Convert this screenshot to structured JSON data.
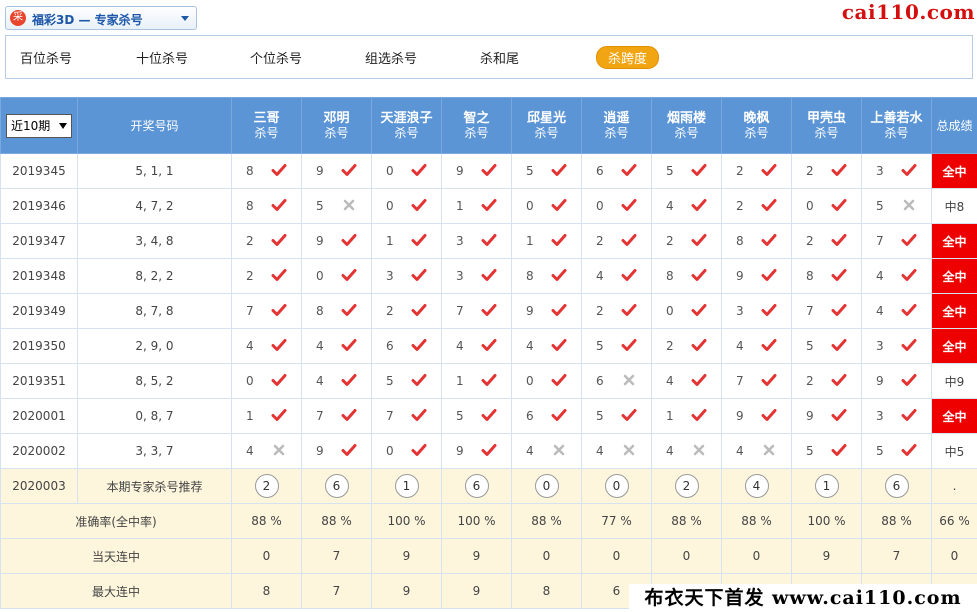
{
  "header": {
    "logo_glyph": "采",
    "game_title": "福彩3D — 专家杀号",
    "site_logo": "cai110.com"
  },
  "tabs": [
    {
      "label": "百位杀号"
    },
    {
      "label": "十位杀号"
    },
    {
      "label": "个位杀号"
    },
    {
      "label": "组选杀号"
    },
    {
      "label": "杀和尾"
    },
    {
      "label": "杀跨度"
    }
  ],
  "table": {
    "period_select": "近10期",
    "draw_header": "开奖号码",
    "total_header": "总成绩",
    "kill_sub": "杀号",
    "experts": [
      "三哥",
      "邓明",
      "天涯浪子",
      "智之",
      "邱星光",
      "逍遥",
      "烟雨楼",
      "晚枫",
      "甲壳虫",
      "上善若水"
    ],
    "rows": [
      {
        "period": "2019345",
        "draw": "5, 1, 1",
        "cells": [
          [
            "8",
            "y"
          ],
          [
            "9",
            "y"
          ],
          [
            "0",
            "y"
          ],
          [
            "9",
            "y"
          ],
          [
            "5",
            "y"
          ],
          [
            "6",
            "y"
          ],
          [
            "5",
            "y"
          ],
          [
            "2",
            "y"
          ],
          [
            "2",
            "y"
          ],
          [
            "3",
            "y"
          ]
        ],
        "total": "全中"
      },
      {
        "period": "2019346",
        "draw": "4, 7, 2",
        "cells": [
          [
            "8",
            "y"
          ],
          [
            "5",
            "n"
          ],
          [
            "0",
            "y"
          ],
          [
            "1",
            "y"
          ],
          [
            "0",
            "y"
          ],
          [
            "0",
            "y"
          ],
          [
            "4",
            "y"
          ],
          [
            "2",
            "y"
          ],
          [
            "0",
            "y"
          ],
          [
            "5",
            "n"
          ]
        ],
        "total": "中8"
      },
      {
        "period": "2019347",
        "draw": "3, 4, 8",
        "cells": [
          [
            "2",
            "y"
          ],
          [
            "9",
            "y"
          ],
          [
            "1",
            "y"
          ],
          [
            "3",
            "y"
          ],
          [
            "1",
            "y"
          ],
          [
            "2",
            "y"
          ],
          [
            "2",
            "y"
          ],
          [
            "8",
            "y"
          ],
          [
            "2",
            "y"
          ],
          [
            "7",
            "y"
          ]
        ],
        "total": "全中"
      },
      {
        "period": "2019348",
        "draw": "8, 2, 2",
        "cells": [
          [
            "2",
            "y"
          ],
          [
            "0",
            "y"
          ],
          [
            "3",
            "y"
          ],
          [
            "3",
            "y"
          ],
          [
            "8",
            "y"
          ],
          [
            "4",
            "y"
          ],
          [
            "8",
            "y"
          ],
          [
            "9",
            "y"
          ],
          [
            "8",
            "y"
          ],
          [
            "4",
            "y"
          ]
        ],
        "total": "全中"
      },
      {
        "period": "2019349",
        "draw": "8, 7, 8",
        "cells": [
          [
            "7",
            "y"
          ],
          [
            "8",
            "y"
          ],
          [
            "2",
            "y"
          ],
          [
            "7",
            "y"
          ],
          [
            "9",
            "y"
          ],
          [
            "2",
            "y"
          ],
          [
            "0",
            "y"
          ],
          [
            "3",
            "y"
          ],
          [
            "7",
            "y"
          ],
          [
            "4",
            "y"
          ]
        ],
        "total": "全中"
      },
      {
        "period": "2019350",
        "draw": "2, 9, 0",
        "cells": [
          [
            "4",
            "y"
          ],
          [
            "4",
            "y"
          ],
          [
            "6",
            "y"
          ],
          [
            "4",
            "y"
          ],
          [
            "4",
            "y"
          ],
          [
            "5",
            "y"
          ],
          [
            "2",
            "y"
          ],
          [
            "4",
            "y"
          ],
          [
            "5",
            "y"
          ],
          [
            "3",
            "y"
          ]
        ],
        "total": "全中"
      },
      {
        "period": "2019351",
        "draw": "8, 5, 2",
        "cells": [
          [
            "0",
            "y"
          ],
          [
            "4",
            "y"
          ],
          [
            "5",
            "y"
          ],
          [
            "1",
            "y"
          ],
          [
            "0",
            "y"
          ],
          [
            "6",
            "n"
          ],
          [
            "4",
            "y"
          ],
          [
            "7",
            "y"
          ],
          [
            "2",
            "y"
          ],
          [
            "9",
            "y"
          ]
        ],
        "total": "中9"
      },
      {
        "period": "2020001",
        "draw": "0, 8, 7",
        "cells": [
          [
            "1",
            "y"
          ],
          [
            "7",
            "y"
          ],
          [
            "7",
            "y"
          ],
          [
            "5",
            "y"
          ],
          [
            "6",
            "y"
          ],
          [
            "5",
            "y"
          ],
          [
            "1",
            "y"
          ],
          [
            "9",
            "y"
          ],
          [
            "9",
            "y"
          ],
          [
            "3",
            "y"
          ]
        ],
        "total": "全中"
      },
      {
        "period": "2020002",
        "draw": "3, 3, 7",
        "cells": [
          [
            "4",
            "n"
          ],
          [
            "9",
            "y"
          ],
          [
            "0",
            "y"
          ],
          [
            "9",
            "y"
          ],
          [
            "4",
            "n"
          ],
          [
            "4",
            "n"
          ],
          [
            "4",
            "n"
          ],
          [
            "4",
            "n"
          ],
          [
            "5",
            "y"
          ],
          [
            "5",
            "y"
          ]
        ],
        "total": "中5"
      }
    ],
    "recommend": {
      "period": "2020003",
      "label": "本期专家杀号推荐",
      "values": [
        "2",
        "6",
        "1",
        "6",
        "0",
        "0",
        "2",
        "4",
        "1",
        "6"
      ],
      "total": "."
    },
    "accuracy": {
      "label": "准确率(全中率)",
      "values": [
        "88 %",
        "88 %",
        "100 %",
        "100 %",
        "88 %",
        "77 %",
        "88 %",
        "88 %",
        "100 %",
        "88 %"
      ],
      "total": "66 %"
    },
    "current_streak": {
      "label": "当天连中",
      "values": [
        "0",
        "7",
        "9",
        "9",
        "0",
        "0",
        "0",
        "0",
        "9",
        "7"
      ],
      "total": "0"
    },
    "max_streak": {
      "label": "最大连中",
      "values": [
        "8",
        "7",
        "9",
        "9",
        "8",
        "6",
        "",
        "",
        "",
        ""
      ],
      "total": ""
    }
  },
  "footer": {
    "brand": "布衣天下首发 www.cai110.com"
  },
  "colors": {
    "header_blue": "#5b95d6",
    "accent_orange": "#f2a513",
    "hit_red": "#e33333",
    "miss_gray": "#bbbbbb",
    "full_hit_bg": "#ee0000"
  }
}
